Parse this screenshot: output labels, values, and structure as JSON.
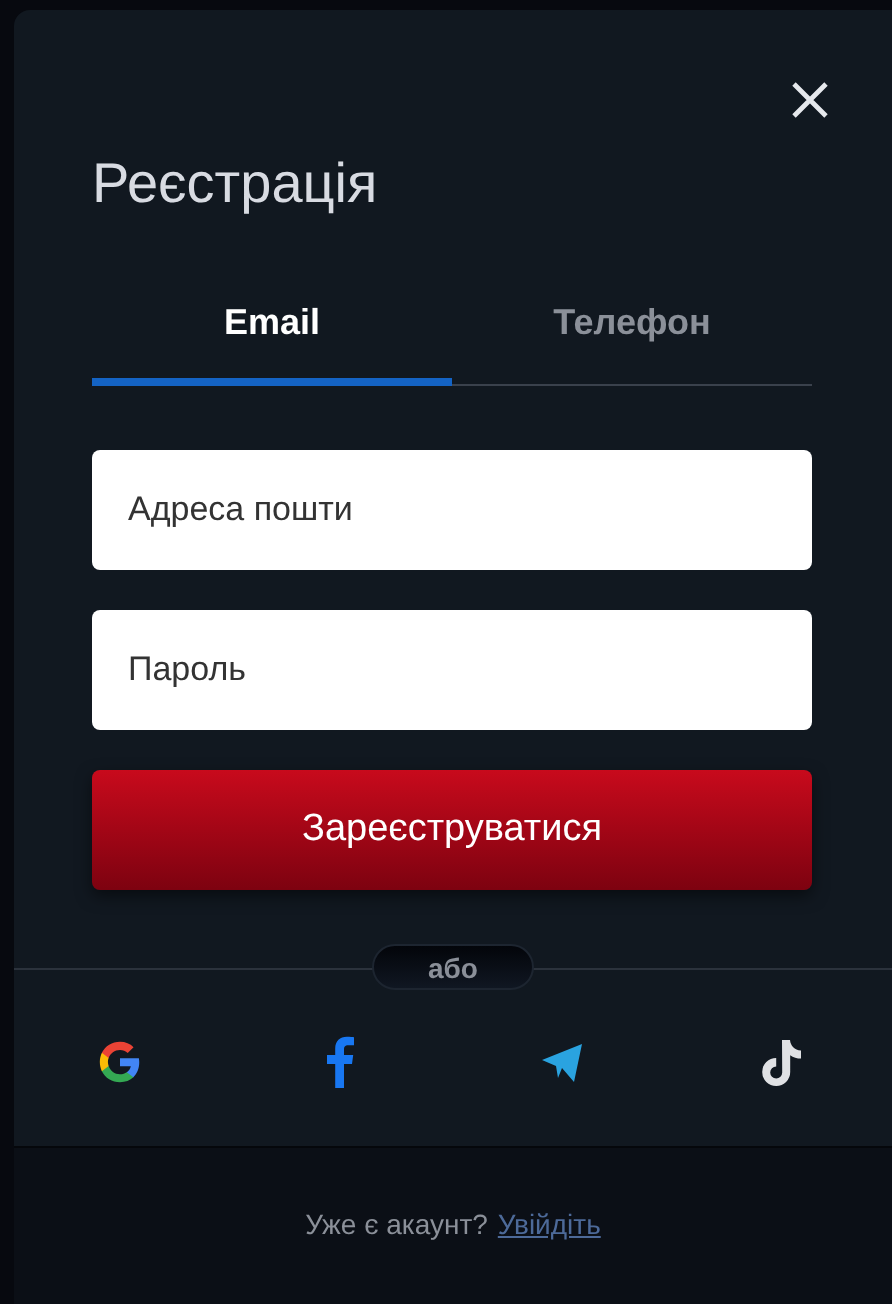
{
  "dialog": {
    "title": "Реєстрація"
  },
  "tabs": [
    {
      "label": "Email",
      "selected": true
    },
    {
      "label": "Телефон",
      "selected": false
    }
  ],
  "fields": [
    {
      "placeholder": "Адреса пошти"
    },
    {
      "placeholder": "Пароль"
    }
  ],
  "submit": "Зареєструватися",
  "divider": "або",
  "footer": {
    "prompt": "Уже є акаунт?",
    "link": "Увійдіть"
  }
}
